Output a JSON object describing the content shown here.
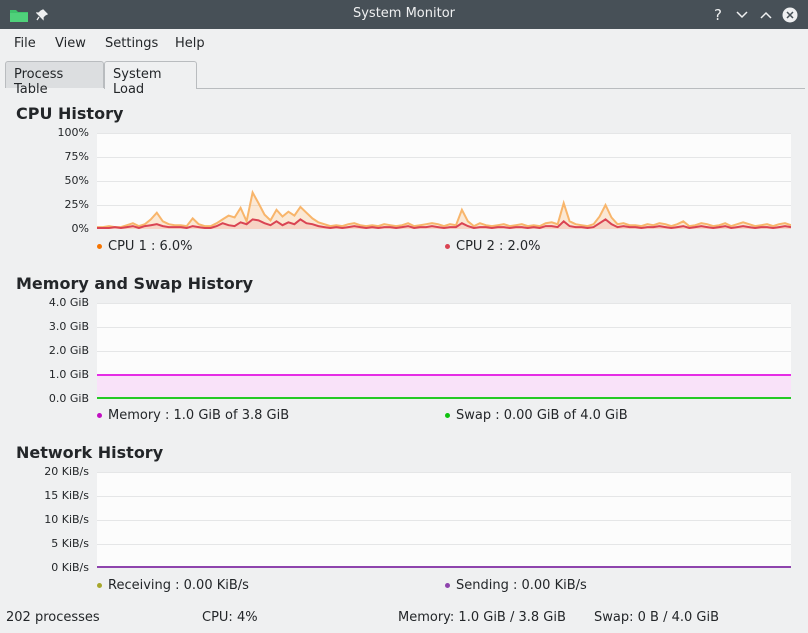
{
  "window": {
    "title": "System Monitor"
  },
  "menu": [
    "File",
    "View",
    "Settings",
    "Help"
  ],
  "tabs": [
    {
      "label": "Process Table",
      "active": false
    },
    {
      "label": "System Load",
      "active": true
    }
  ],
  "cpu": {
    "title": "CPU History",
    "yticks": [
      "100%",
      "75%",
      "50%",
      "25%",
      "0%"
    ],
    "legend": [
      {
        "label": "CPU 1 : 6.0%",
        "color": "#f67400"
      },
      {
        "label": "CPU 2 : 2.0%",
        "color": "#da4453"
      }
    ],
    "chart_data": {
      "type": "area",
      "ylim": [
        0,
        100
      ],
      "series": [
        {
          "name": "CPU 1",
          "color": "#f8b56b",
          "values": [
            2,
            2,
            3,
            2,
            2,
            4,
            6,
            3,
            5,
            10,
            17,
            8,
            5,
            4,
            4,
            3,
            11,
            5,
            3,
            3,
            6,
            10,
            14,
            12,
            22,
            8,
            38,
            27,
            15,
            9,
            20,
            13,
            18,
            14,
            23,
            17,
            11,
            7,
            5,
            3,
            4,
            3,
            5,
            6,
            4,
            3,
            4,
            3,
            5,
            4,
            3,
            4,
            6,
            3,
            4,
            5,
            6,
            5,
            3,
            5,
            4,
            20,
            8,
            3,
            6,
            4,
            3,
            4,
            5,
            3,
            4,
            5,
            3,
            4,
            3,
            6,
            7,
            5,
            27,
            8,
            5,
            4,
            3,
            5,
            13,
            25,
            12,
            5,
            6,
            4,
            4,
            3,
            5,
            4,
            6,
            5,
            3,
            5,
            8,
            3,
            4,
            6,
            5,
            3,
            4,
            6,
            3,
            5,
            7,
            5,
            3,
            4,
            5,
            3,
            5,
            6,
            4
          ]
        },
        {
          "name": "CPU 2",
          "color": "#da4453",
          "values": [
            1,
            1,
            1,
            2,
            1,
            2,
            3,
            1,
            3,
            4,
            5,
            3,
            2,
            2,
            2,
            1,
            3,
            2,
            1,
            1,
            3,
            6,
            4,
            3,
            7,
            5,
            10,
            9,
            6,
            4,
            8,
            4,
            7,
            5,
            10,
            6,
            5,
            3,
            2,
            1,
            2,
            1,
            2,
            3,
            2,
            1,
            2,
            1,
            2,
            2,
            1,
            2,
            3,
            1,
            2,
            2,
            3,
            2,
            1,
            2,
            2,
            6,
            3,
            1,
            2,
            2,
            1,
            2,
            2,
            1,
            2,
            2,
            1,
            2,
            1,
            3,
            3,
            2,
            8,
            3,
            2,
            2,
            1,
            2,
            6,
            10,
            5,
            2,
            3,
            2,
            2,
            1,
            2,
            2,
            3,
            2,
            1,
            2,
            3,
            1,
            2,
            3,
            2,
            1,
            2,
            3,
            1,
            2,
            3,
            2,
            1,
            2,
            2,
            1,
            2,
            3,
            2
          ]
        }
      ]
    }
  },
  "memory": {
    "title": "Memory and Swap History",
    "yticks": [
      "4.0 GiB",
      "3.0 GiB",
      "2.0 GiB",
      "1.0 GiB",
      "0.0 GiB"
    ],
    "legend": [
      {
        "label": "Memory : 1.0 GiB of 3.8 GiB",
        "color": "#c20fc2"
      },
      {
        "label": "Swap : 0.00 GiB of 4.0 GiB",
        "color": "#0fc20f"
      }
    ],
    "chart_data": {
      "type": "line",
      "ylim": [
        0,
        4
      ],
      "series": [
        {
          "name": "Memory",
          "color": "#e52de5",
          "values": [
            1.0,
            1.0
          ]
        },
        {
          "name": "Swap",
          "color": "#26c926",
          "values": [
            0.0,
            0.0
          ]
        }
      ]
    }
  },
  "network": {
    "title": "Network History",
    "yticks": [
      "20 KiB/s",
      "15 KiB/s",
      "10 KiB/s",
      "5 KiB/s",
      "0 KiB/s"
    ],
    "legend": [
      {
        "label": "Receiving : 0.00 KiB/s",
        "color": "#a7a72c"
      },
      {
        "label": "Sending : 0.00 KiB/s",
        "color": "#8e44ad"
      }
    ],
    "chart_data": {
      "type": "line",
      "ylim": [
        0,
        20
      ],
      "series": [
        {
          "name": "Receiving",
          "color": "#e6e61a",
          "values": [
            0,
            0
          ]
        },
        {
          "name": "Sending",
          "color": "#8e44ad",
          "values": [
            0,
            0
          ]
        }
      ]
    }
  },
  "status": {
    "processes": "202 processes",
    "cpu": "CPU: 4%",
    "memory": "Memory: 1.0 GiB / 3.8 GiB",
    "swap": "Swap: 0 B / 4.0 GiB"
  }
}
